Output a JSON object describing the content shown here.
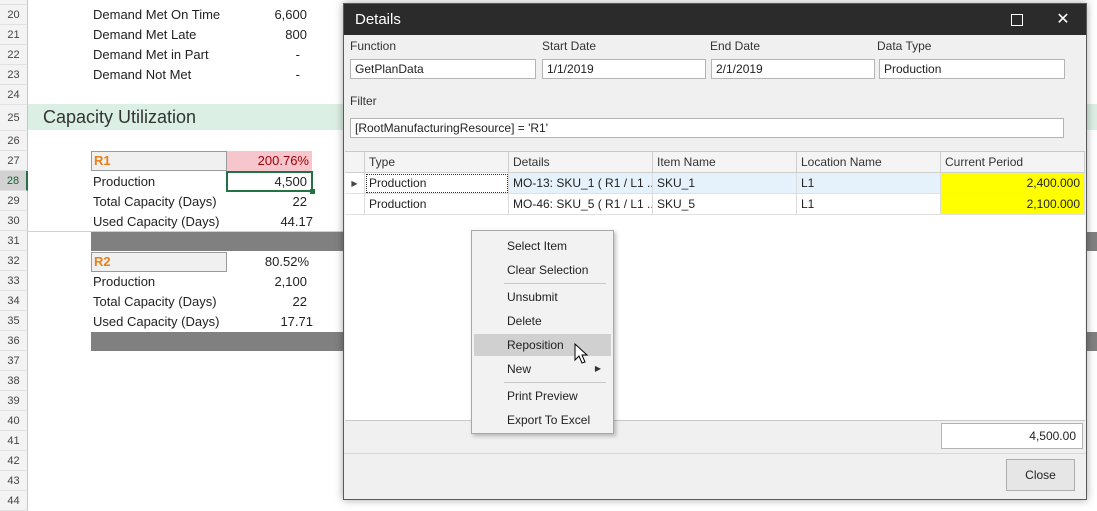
{
  "sheet": {
    "row_numbers": [
      "20",
      "21",
      "22",
      "23",
      "24",
      "25",
      "26",
      "27",
      "28",
      "29",
      "30",
      "31",
      "32",
      "33",
      "34",
      "35",
      "36",
      "37",
      "38",
      "39",
      "40",
      "41",
      "42",
      "43",
      "44"
    ],
    "demand_rows": [
      {
        "label": "Demand Met On Time",
        "value": "6,600"
      },
      {
        "label": "Demand Met Late",
        "value": "800"
      },
      {
        "label": "Demand Met in Part",
        "value": "-"
      },
      {
        "label": "Demand Not Met",
        "value": "-"
      }
    ],
    "section_title": "Capacity Utilization",
    "r1": {
      "label": "R1",
      "pct": "200.76%",
      "production_label": "Production",
      "production": "4,500",
      "total_label": "Total Capacity (Days)",
      "total": "22",
      "used_label": "Used Capacity (Days)",
      "used": "44.17"
    },
    "r2": {
      "label": "R2",
      "pct": "80.52%",
      "production_label": "Production",
      "production": "2,100",
      "total_label": "Total Capacity (Days)",
      "total": "22",
      "used_label": "Used Capacity (Days)",
      "used": "17.71"
    },
    "colors": {
      "section_band": "#dcefe4",
      "r1_pct_fill": "#f7c5cc",
      "gray_band": "#808080",
      "excel_green": "#217346"
    }
  },
  "dialog": {
    "title": "Details",
    "function_label": "Function",
    "function_value": "GetPlanData",
    "start_label": "Start Date",
    "start_value": "1/1/2019",
    "end_label": "End  Date",
    "end_value": "2/1/2019",
    "datatype_label": "Data Type",
    "datatype_value": "Production",
    "filter_label": "Filter",
    "filter_value": "[RootManufacturingResource] = 'R1'",
    "grid": {
      "columns": [
        "Type",
        "Details",
        "Item Name",
        "Location Name",
        "Current Period"
      ],
      "rows": [
        {
          "type": "Production",
          "details": "MO-13: SKU_1 ( R1 / L1 ...",
          "item": "SKU_1",
          "location": "L1",
          "current": "2,400.000"
        },
        {
          "type": "Production",
          "details": "MO-46: SKU_5 ( R1 / L1 ...",
          "item": "SKU_5",
          "location": "L1",
          "current": "2,100.000"
        }
      ]
    },
    "total": "4,500.00",
    "close_label": "Close"
  },
  "context_menu": {
    "items": [
      "Select Item",
      "Clear Selection",
      "Unsubmit",
      "Delete",
      "Reposition",
      "New",
      "Print Preview",
      "Export To Excel"
    ],
    "hovered": "Reposition"
  }
}
